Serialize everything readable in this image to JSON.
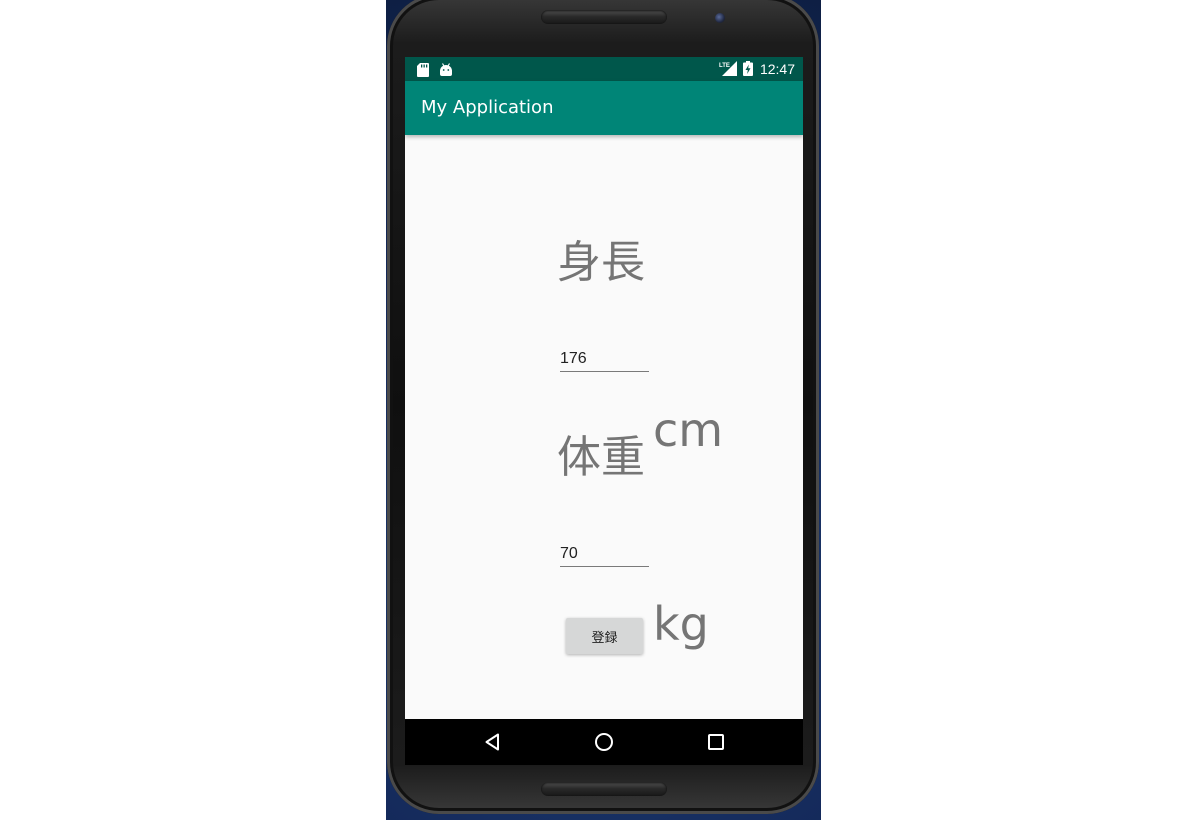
{
  "status_bar": {
    "time": "12:47",
    "icons": [
      "sd-card-icon",
      "android-debug-icon",
      "lte-signal-icon",
      "battery-charging-icon"
    ]
  },
  "app_bar": {
    "title": "My Application",
    "color": "#008577",
    "status_color": "#00574b"
  },
  "form": {
    "height_label": "身長",
    "height_value": "176",
    "height_unit": "cm",
    "weight_label": "体重",
    "weight_value": "70",
    "weight_unit": "kg",
    "submit_label": "登録"
  },
  "nav_bar": {
    "buttons": [
      "back-icon",
      "home-icon",
      "recents-icon"
    ]
  }
}
